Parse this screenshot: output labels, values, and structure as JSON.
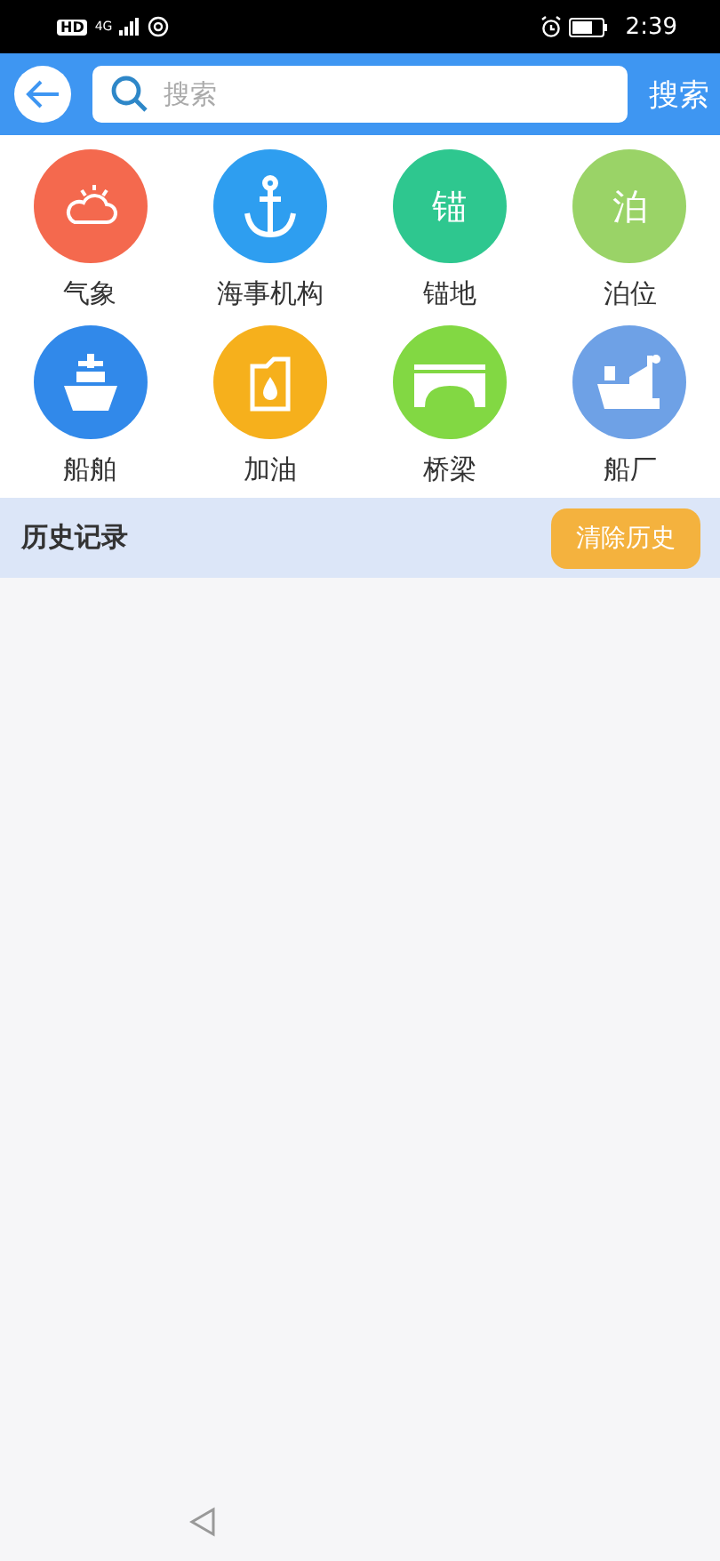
{
  "status_bar": {
    "hd_badge": "HD",
    "network": "4G",
    "time": "2:39"
  },
  "search_bar": {
    "placeholder": "搜索",
    "button": "搜索"
  },
  "categories": [
    {
      "label": "气象",
      "kind": "weather",
      "color": "#f4694e"
    },
    {
      "label": "海事机构",
      "kind": "anchor",
      "color": "#2e9ef0"
    },
    {
      "label": "锚地",
      "kind": "glyph",
      "glyph": "锚",
      "color": "#2ec78f"
    },
    {
      "label": "泊位",
      "kind": "glyph",
      "glyph": "泊",
      "color": "#9ad367"
    },
    {
      "label": "船舶",
      "kind": "ship",
      "color": "#3189ea"
    },
    {
      "label": "加油",
      "kind": "oil",
      "color": "#f6b01c"
    },
    {
      "label": "桥梁",
      "kind": "bridge",
      "color": "#82d843"
    },
    {
      "label": "船厂",
      "kind": "shipyard",
      "color": "#6ea1e6"
    }
  ],
  "history": {
    "title": "历史记录",
    "clear_button": "清除历史"
  }
}
